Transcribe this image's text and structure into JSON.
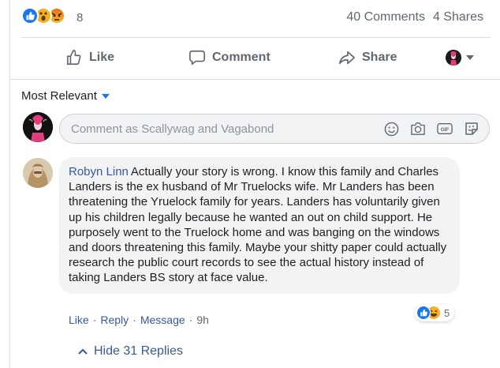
{
  "summary": {
    "reaction_icons": [
      "like-icon",
      "wow-icon",
      "angry-icon"
    ],
    "reaction_count": "8",
    "comments": "40 Comments",
    "shares": "4 Shares"
  },
  "actions": {
    "like": "Like",
    "comment": "Comment",
    "share": "Share"
  },
  "sort": {
    "label": "Most Relevant"
  },
  "composer": {
    "placeholder": "Comment as Scallywag and Vagabond",
    "icons": [
      "emoji-icon",
      "camera-icon",
      "gif-icon",
      "sticker-icon"
    ],
    "gif_label": "GIF"
  },
  "comment": {
    "author": "Robyn Linn",
    "text": "Actually your story is wrong. I know this family and Charles Landers is the ex husband of Mr Truelocks wife. Mr Landers has been threatening the Yruelock family for years. Landers has voluntarily given up his children legally because he wanted an out on child support. He purposely went to the Truelock home and was banging on the windows and doors threatening this family. Maybe your shitty paper could actually research the public court records to see the actual history instead of taking Landers BS story at face value.",
    "reaction_count": "5",
    "like": "Like",
    "reply": "Reply",
    "message": "Message",
    "time": "9h",
    "sep": "·"
  },
  "replies": {
    "label": "Hide 31 Replies"
  },
  "colors": {
    "link": "#385898",
    "like_blue": "#1877f2",
    "muted": "#606770"
  }
}
